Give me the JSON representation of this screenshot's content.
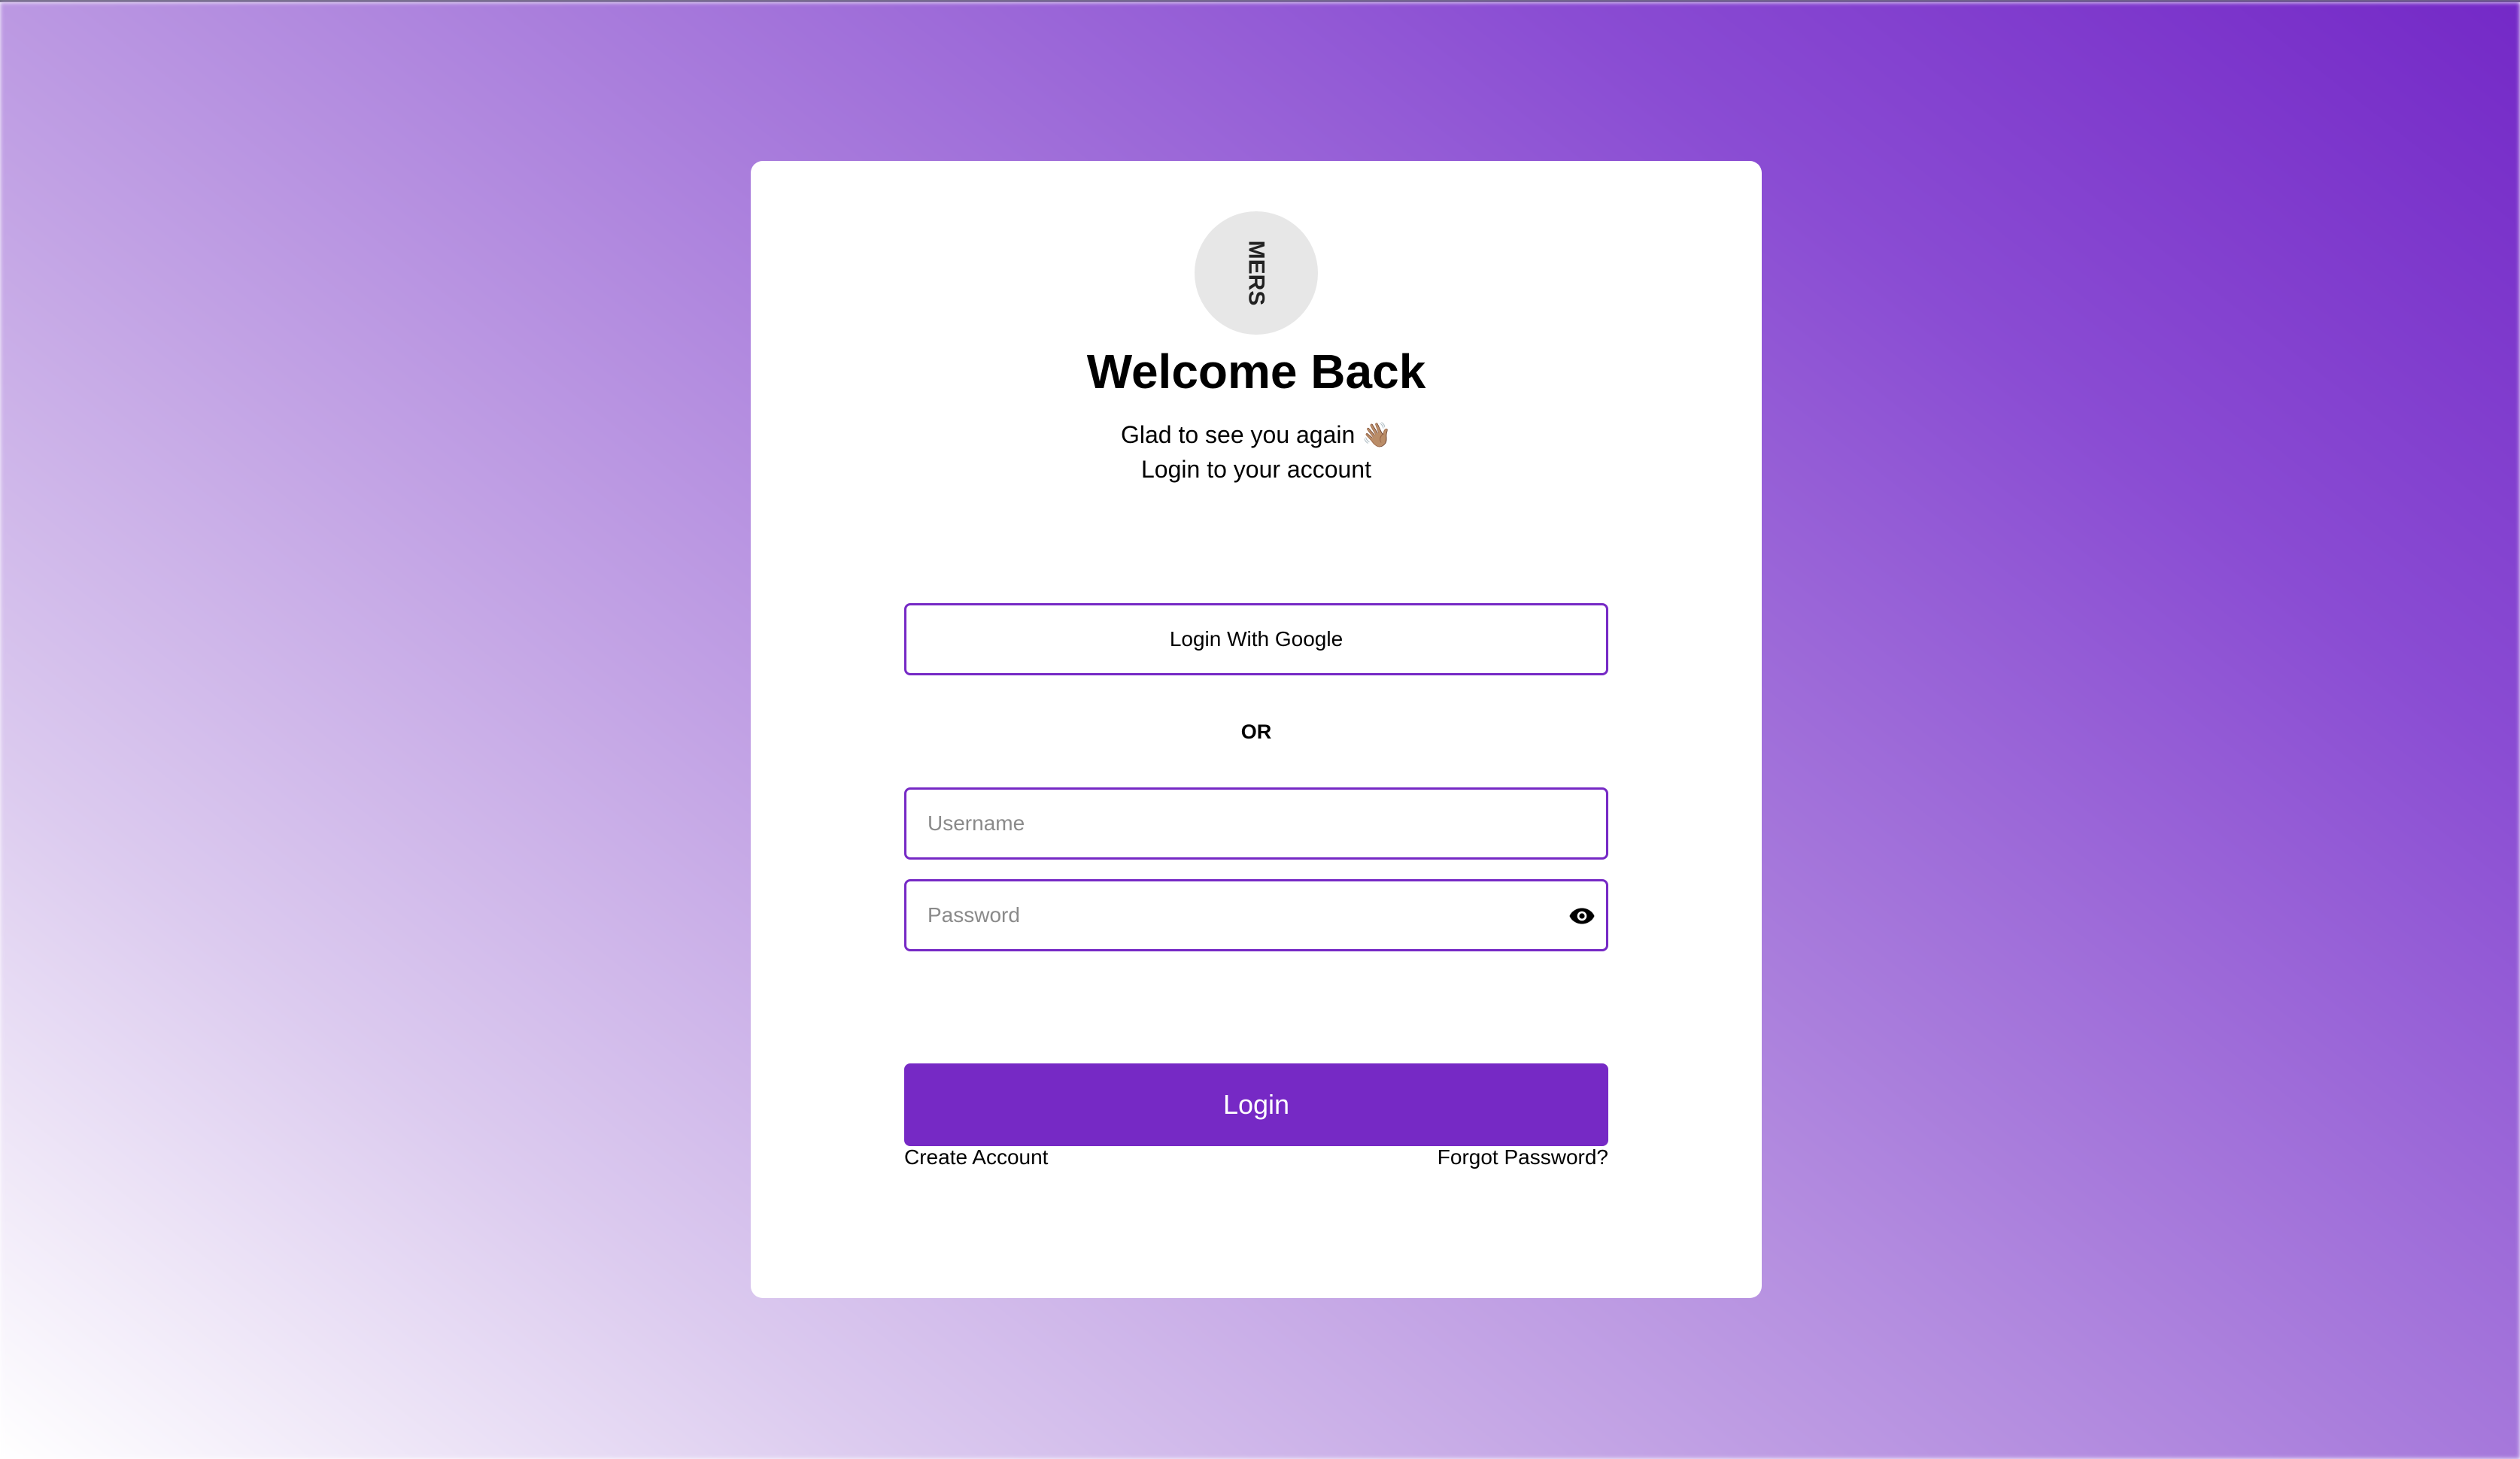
{
  "colors": {
    "accent": "#7629c5",
    "logo_background": "#e7e7e7",
    "card_background": "#ffffff"
  },
  "logo": {
    "text": "MERS",
    "icon": "brand-logo-icon"
  },
  "header": {
    "title": "Welcome Back",
    "subtitle_line1": "Glad to see you again 👋🏽",
    "subtitle_line2": "Login to your account"
  },
  "google_button": {
    "label": "Login With Google"
  },
  "divider": {
    "label": "OR"
  },
  "form": {
    "username": {
      "placeholder": "Username",
      "value": ""
    },
    "password": {
      "placeholder": "Password",
      "value": "",
      "toggle_icon": "eye-icon"
    }
  },
  "links": {
    "create_account": "Create Account",
    "forgot_password": "Forgot Password?"
  },
  "login_button": {
    "label": "Login"
  }
}
